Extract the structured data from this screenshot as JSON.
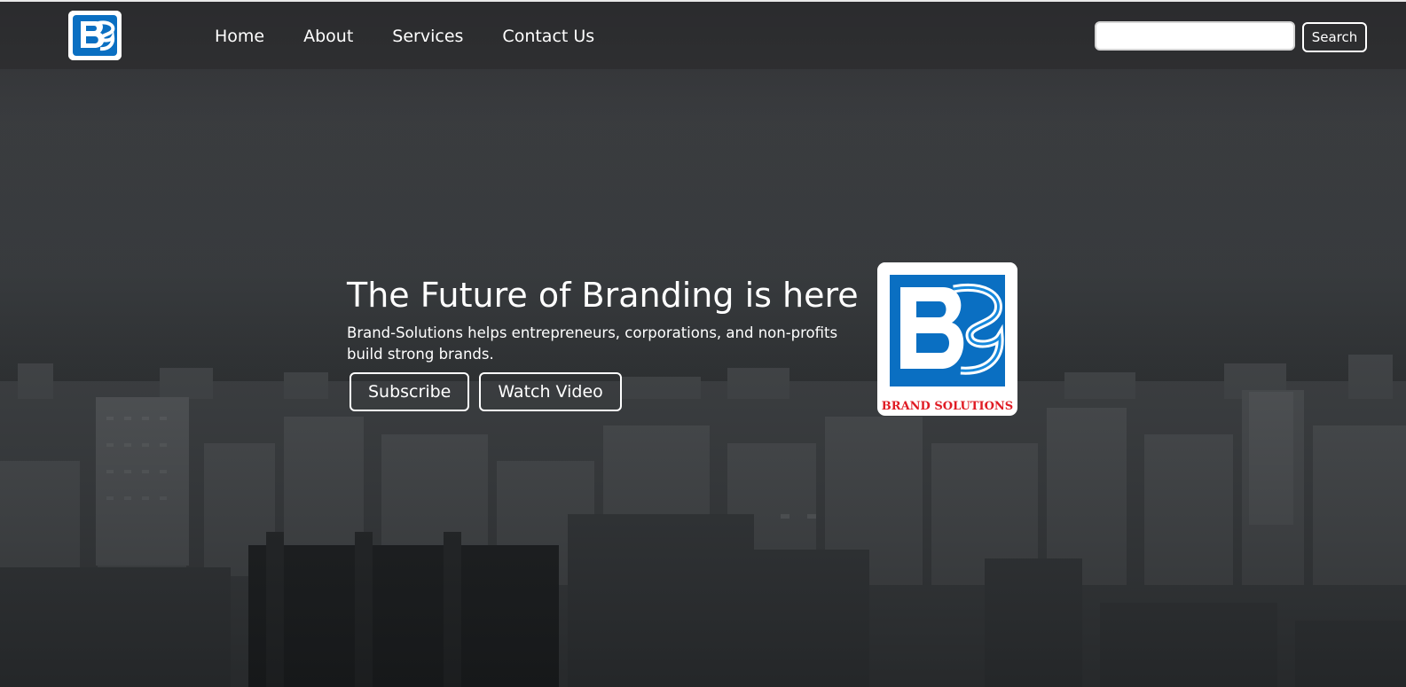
{
  "brand": {
    "logo_icon": "bs-logo-icon",
    "logo_caption": "BRAND SOLUTIONS",
    "logo_blue": "#0a6fc2",
    "caption_red": "#e01b24"
  },
  "nav": {
    "items": [
      {
        "label": "Home"
      },
      {
        "label": "About"
      },
      {
        "label": "Services"
      },
      {
        "label": "Contact Us"
      }
    ]
  },
  "search": {
    "value": "",
    "placeholder": "",
    "button_label": "Search"
  },
  "hero": {
    "title": "The Future of Branding is here",
    "subtitle": "Brand-Solutions helps entrepreneurs, corporations, and non-profits build strong brands.",
    "subscribe_label": "Subscribe",
    "watch_label": "Watch Video"
  },
  "background": {
    "image": "city-skyline-dusk-image"
  }
}
